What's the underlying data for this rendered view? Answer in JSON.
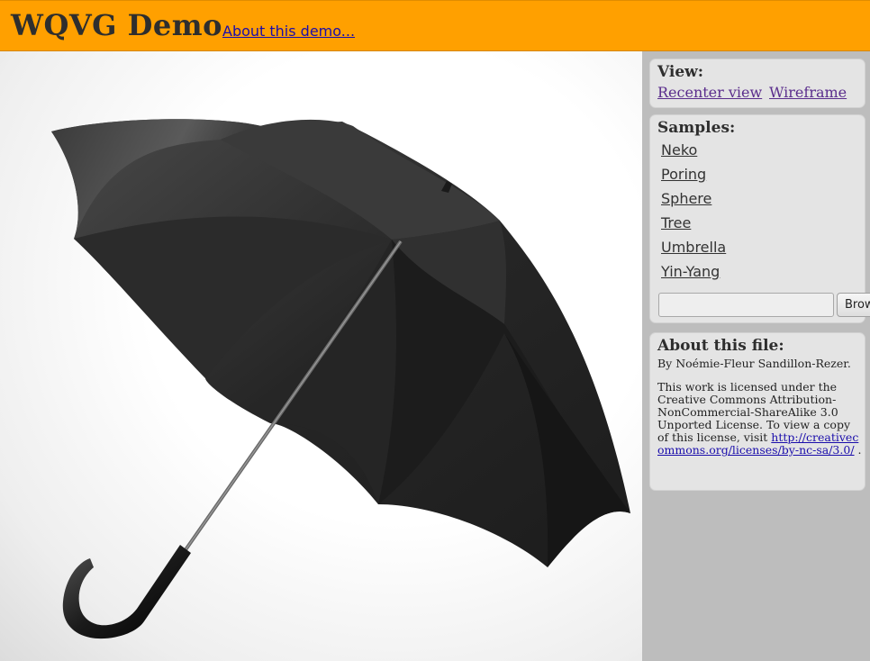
{
  "header": {
    "title": "WQVG Demo",
    "about_link": "About this demo..."
  },
  "view_panel": {
    "title": "View:",
    "recenter": "Recenter view",
    "wireframe": "Wireframe"
  },
  "samples_panel": {
    "title": "Samples:",
    "items": [
      "Neko",
      "Poring",
      "Sphere",
      "Tree",
      "Umbrella",
      "Yin-Yang"
    ],
    "browse_label": "Browse..."
  },
  "file_panel": {
    "title": "About this file:",
    "author": "By Noémie-Fleur Sandillon-Rezer.",
    "license_text": "This work is licensed under the Creative Commons Attribution-NonCommercial-ShareAlike 3.0 Unported License. To view a copy of this license, visit",
    "license_url": "http://creativecommons.org/licenses/by-nc-sa/3.0/",
    "license_suffix": " ."
  },
  "colors": {
    "header_bg": "#ffa000",
    "sidebar_bg": "#bdbdbd",
    "panel_bg": "#e4e4e4",
    "umbrella": "#2a2a2a"
  },
  "viewer": {
    "subject": "umbrella-image"
  }
}
